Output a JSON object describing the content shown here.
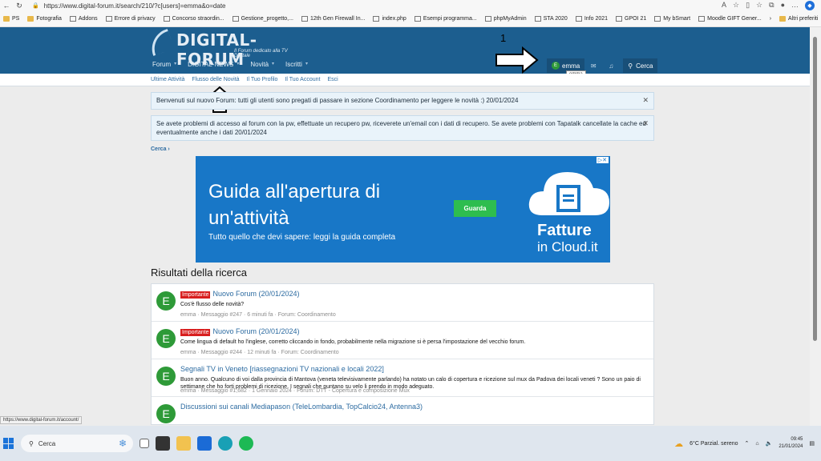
{
  "browser": {
    "url": "https://www.digital-forum.it/search/210/?c[users]=emma&o=date",
    "bookmarks": [
      "PS",
      "Fotografia",
      "Addons",
      "Errore di privacy",
      "Concorso straordin...",
      "Gestione_progetto,...",
      "12th Gen Firewall In...",
      "index.php",
      "Esempi programma...",
      "phpMyAdmin",
      "STA 2020",
      "Info 2021",
      "GPOI 21",
      "My bSmart",
      "Moodle GIFT Gener..."
    ],
    "other_bookmarks": "Altri preferiti"
  },
  "header": {
    "logo_title": "DIGITAL-FORUM",
    "logo_subtitle": "Il Forum dedicato alla TV Digitale",
    "nav": [
      "Forum",
      "DIGITAL-NEWS",
      "Novità",
      "Iscritti"
    ],
    "user": "emma",
    "user_initial": "E",
    "search": "Cerca",
    "tooltip": "emma"
  },
  "annotations": {
    "one": "1",
    "two": "2"
  },
  "subnav": [
    "Ultime Attività",
    "Flusso delle Novità",
    "Il Tuo Profilo",
    "Il Tuo Account",
    "Esci"
  ],
  "notices": [
    "Benvenuti sul nuovo Forum: tutti gli utenti sono pregati di passare in sezione Coordinamento per leggere le novità :) 20/01/2024",
    "Se avete problemi di accesso al forum con la pw, effettuate un recupero pw, riceverete un'email con i dati di recupero. Se avete problemi con Tapatalk cancellate la cache ed eventualmente anche i dati 20/01/2024"
  ],
  "breadcrumb": "Cerca",
  "ad": {
    "headline": "Guida all'apertura di un'attività",
    "sub": "Tutto quello che devi sapere: leggi la guida completa",
    "button": "Guarda",
    "brand1": "Fatture",
    "brand2": "in Cloud.it"
  },
  "results_title": "Risultati della ricerca",
  "results": [
    {
      "badge": "Importante",
      "title": "Nuovo Forum (20/01/2024)",
      "snippet": "Cos'è flusso delle novità?",
      "meta": "emma · Messaggio #247 · 6 minuti fa · Forum: Coordinamento"
    },
    {
      "badge": "Importante",
      "title": "Nuovo Forum (20/01/2024)",
      "snippet": "Come lingua di default ho l'inglese, corretto cliccando in fondo, probabilmente nella migrazione si è persa l'impostazione del vecchio forum.",
      "meta": "emma · Messaggio #244 · 12 minuti fa · Forum: Coordinamento"
    },
    {
      "badge": "",
      "title": "Segnali TV in Veneto [riassegnazioni TV nazionali e locali 2022]",
      "snippet": "Buon anno. Qualcuno di voi dalla provincia di Mantova (veneta televisivamente parlando) ha notato un calo di copertura e ricezione sul mux da Padova dei locali veneti ? Sono un paio di settimane che ho forti problemi di ricezione. I segnali che puntano su velo li prendo in modo adeguato.",
      "meta": "emma · Messaggio #1,682 · 1 Gennaio 2024 · Forum: DTT - Copertura e composizione Mux"
    },
    {
      "badge": "",
      "title": "Discussioni sui canali Mediapason (TeleLombardia, TopCalcio24, Antenna3)",
      "snippet": "",
      "meta": ""
    }
  ],
  "status_url": "https://www.digital-forum.it/account/",
  "taskbar": {
    "search": "Cerca",
    "weather": "6°C  Parzial. sereno",
    "time": "09:45",
    "date": "21/01/2024"
  }
}
